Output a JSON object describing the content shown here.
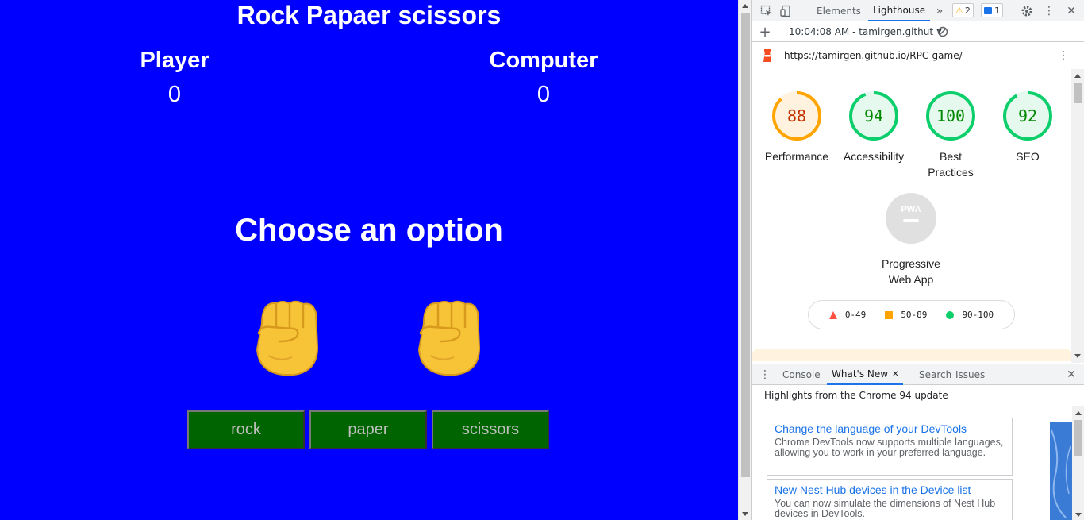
{
  "game": {
    "title": "Rock Papaer scissors",
    "player_label": "Player",
    "computer_label": "Computer",
    "player_score": "0",
    "computer_score": "0",
    "prompt": "Choose an option",
    "player_hand_icon": "raised-fist-emoji",
    "computer_hand_icon": "raised-fist-emoji",
    "buttons": [
      "rock",
      "paper",
      "scissors"
    ],
    "background_color": "#0000ff",
    "button_color": "#006400"
  },
  "devtools": {
    "tabs": [
      "Elements",
      "Lighthouse"
    ],
    "active_tab": "Lighthouse",
    "warnings_count": "2",
    "messages_count": "1",
    "report_time": "10:04:08 AM - tamirgen.githut",
    "url": "https://tamirgen.github.io/RPC-game/",
    "scores": [
      {
        "label": "Performance",
        "value": "88",
        "score": 88,
        "color": "#ffa400"
      },
      {
        "label": "Accessibility",
        "value": "94",
        "score": 94,
        "color": "#0cce6b"
      },
      {
        "label": "Best Practices",
        "value": "100",
        "score": 100,
        "color": "#0cce6b"
      },
      {
        "label": "SEO",
        "value": "92",
        "score": 92,
        "color": "#0cce6b"
      }
    ],
    "pwa": {
      "badge": "PWA",
      "label": "Progressive Web App"
    },
    "legend": [
      {
        "range": "0-49",
        "shape": "triangle",
        "color": "#ff4e42"
      },
      {
        "range": "50-89",
        "shape": "square",
        "color": "#ffa400"
      },
      {
        "range": "90-100",
        "shape": "circle",
        "color": "#0cce6b"
      }
    ],
    "drawer_tabs": [
      "Console",
      "What's New",
      "Search",
      "Issues"
    ],
    "drawer_active_tab": "What's New",
    "highlights_text": "Highlights from the Chrome 94 update",
    "whats_new": [
      {
        "title": "Change the language of your DevTools",
        "body": "Chrome DevTools now supports multiple languages, allowing you to work in your preferred language."
      },
      {
        "title": "New Nest Hub devices in the Device list",
        "body": "You can now simulate the dimensions of Nest Hub devices in DevTools."
      }
    ]
  }
}
